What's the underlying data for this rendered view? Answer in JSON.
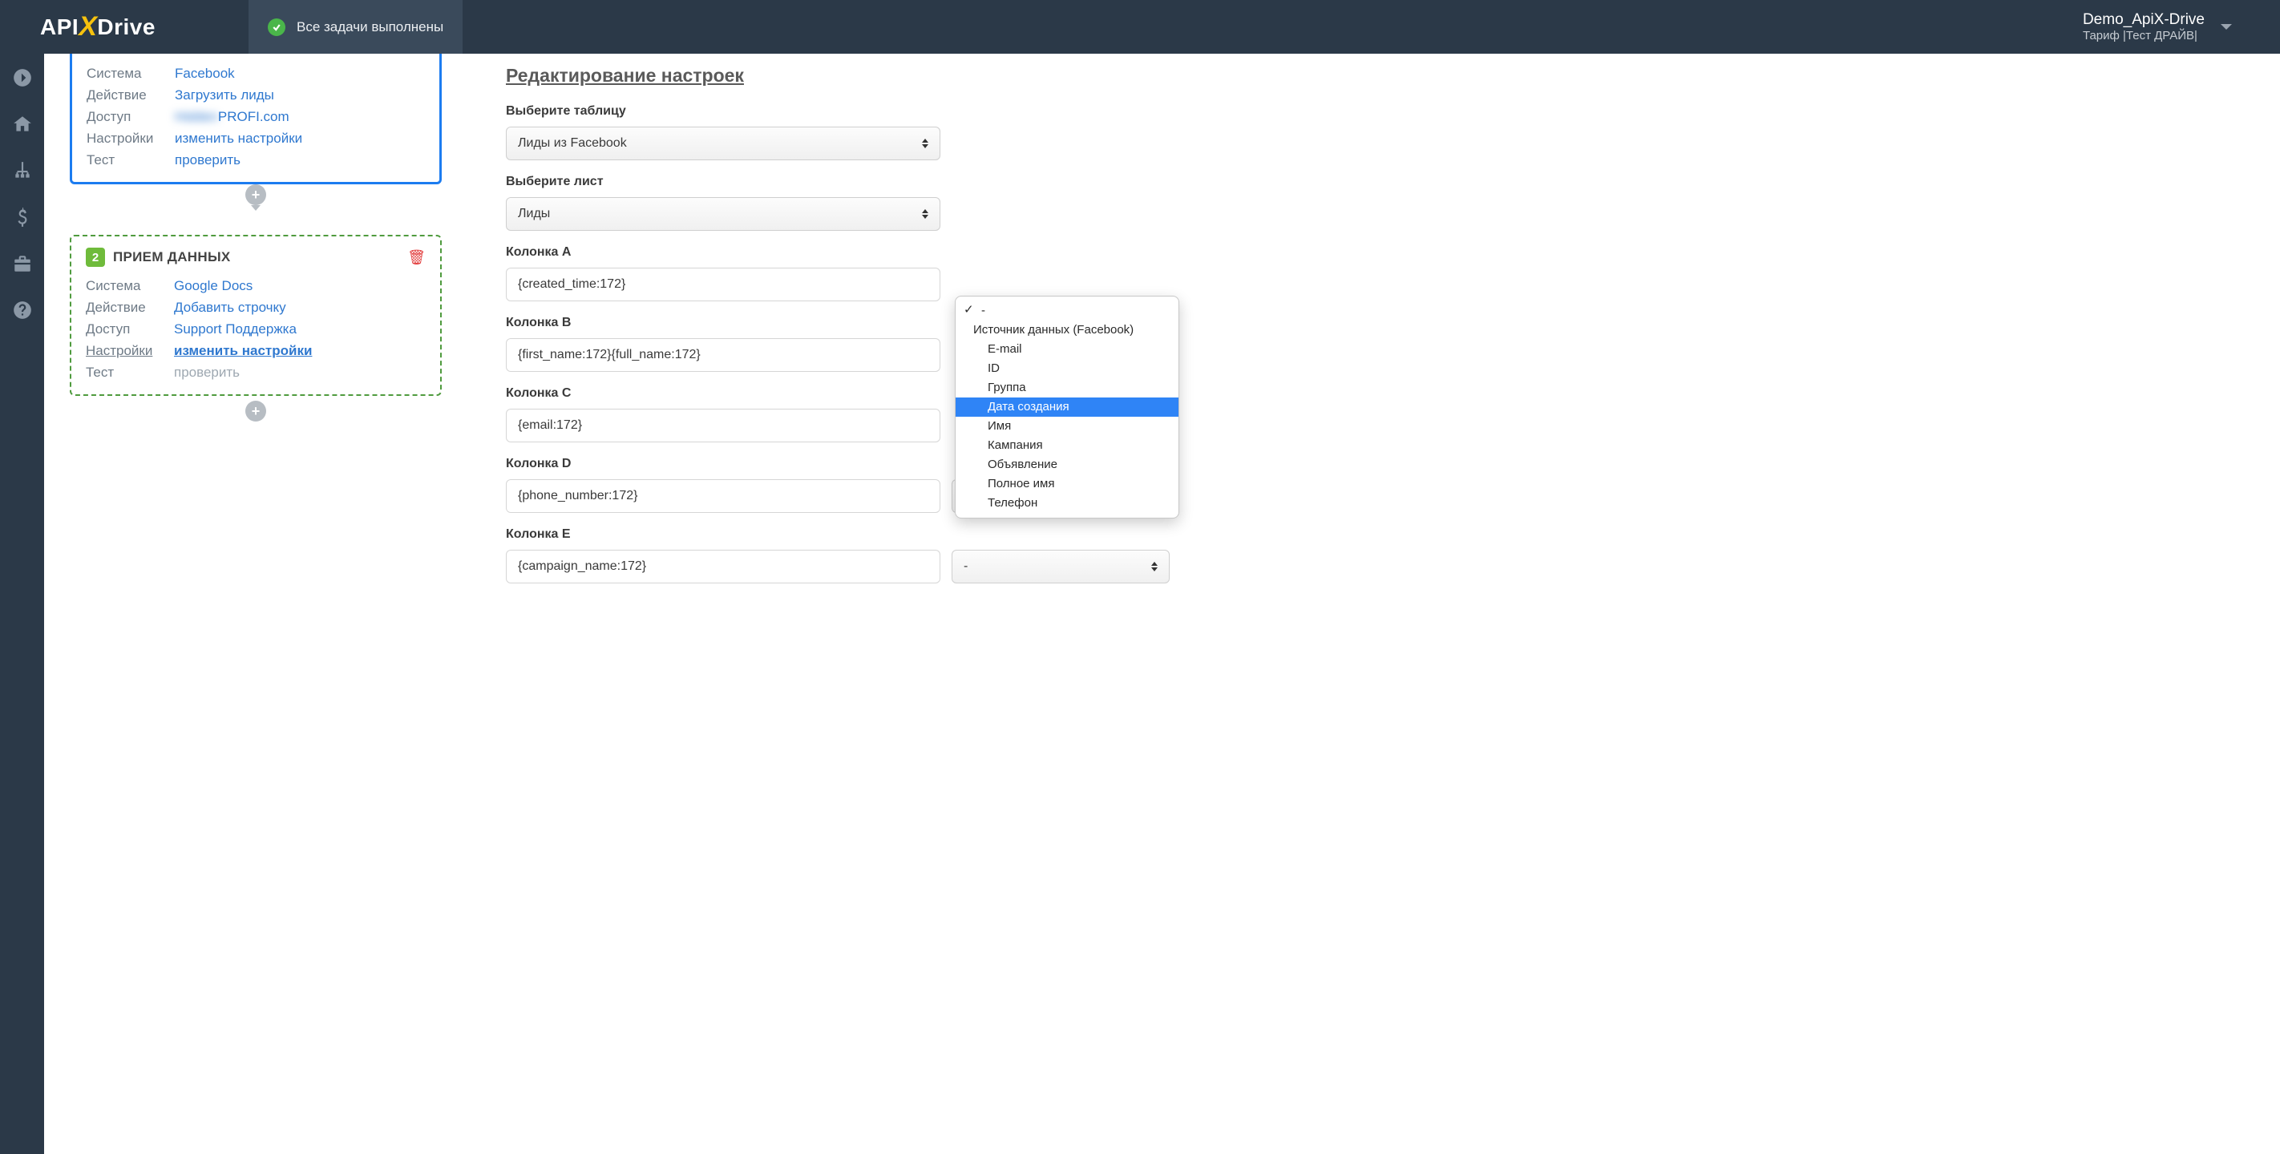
{
  "header": {
    "logo": {
      "api": "API",
      "x": "X",
      "drive": "Drive"
    },
    "status": "Все задачи выполнены",
    "account_name": "Demo_ApiX-Drive",
    "account_plan": "Тариф |Тест ДРАЙВ|"
  },
  "source_card": {
    "rows": {
      "system": {
        "label": "Система",
        "value": "Facebook"
      },
      "action": {
        "label": "Действие",
        "value": "Загрузить лиды"
      },
      "access": {
        "label": "Доступ",
        "value_hidden": "Hidden",
        "value_suffix": "PROFI.com"
      },
      "settings": {
        "label": "Настройки",
        "value": "изменить настройки"
      },
      "test": {
        "label": "Тест",
        "value": "проверить"
      }
    }
  },
  "receiver_card": {
    "badge": "2",
    "title": "ПРИЕМ ДАННЫХ",
    "rows": {
      "system": {
        "label": "Система",
        "value": "Google Docs"
      },
      "action": {
        "label": "Действие",
        "value": "Добавить строчку"
      },
      "access": {
        "label": "Доступ",
        "value": "Support Поддержка"
      },
      "settings": {
        "label": "Настройки",
        "value": "изменить настройки"
      },
      "test": {
        "label": "Тест",
        "value": "проверить"
      }
    }
  },
  "right": {
    "title": "Редактирование настроек",
    "table_label": "Выберите таблицу",
    "table_value": "Лиды из Facebook",
    "sheet_label": "Выберите лист",
    "sheet_value": "Лиды",
    "columns": [
      {
        "label": "Колонка A",
        "value": "{created_time:172}"
      },
      {
        "label": "Колонка B",
        "value": "{first_name:172}{full_name:172}"
      },
      {
        "label": "Колонка C",
        "value": "{email:172}"
      },
      {
        "label": "Колонка D",
        "value": "{phone_number:172}",
        "picker": "-"
      },
      {
        "label": "Колонка E",
        "value": "{campaign_name:172}",
        "picker": "-"
      }
    ]
  },
  "dropdown": {
    "dash": "-",
    "group": "Источник данных (Facebook)",
    "items": [
      "E-mail",
      "ID",
      "Группа",
      "Дата создания",
      "Имя",
      "Кампания",
      "Объявление",
      "Полное имя",
      "Телефон"
    ],
    "selected": "Дата создания"
  }
}
